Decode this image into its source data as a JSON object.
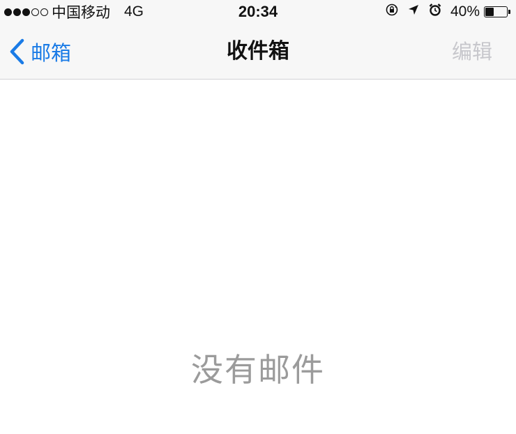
{
  "status_bar": {
    "signal_bars_filled": 3,
    "signal_bars_total": 5,
    "carrier": "中国移动",
    "network": "4G",
    "time": "20:34",
    "icons": [
      "orientation-lock-icon",
      "location-arrow-icon",
      "alarm-clock-icon"
    ],
    "battery_percent": "40%",
    "battery_level": 0.4
  },
  "nav_bar": {
    "back_label": "邮箱",
    "title": "收件箱",
    "edit_label": "编辑"
  },
  "content": {
    "empty_message": "没有邮件"
  },
  "colors": {
    "accent": "#1a7be6",
    "disabled": "#c7c7cc",
    "empty_text": "#9b9b9b",
    "bar_background": "#f7f7f7"
  }
}
